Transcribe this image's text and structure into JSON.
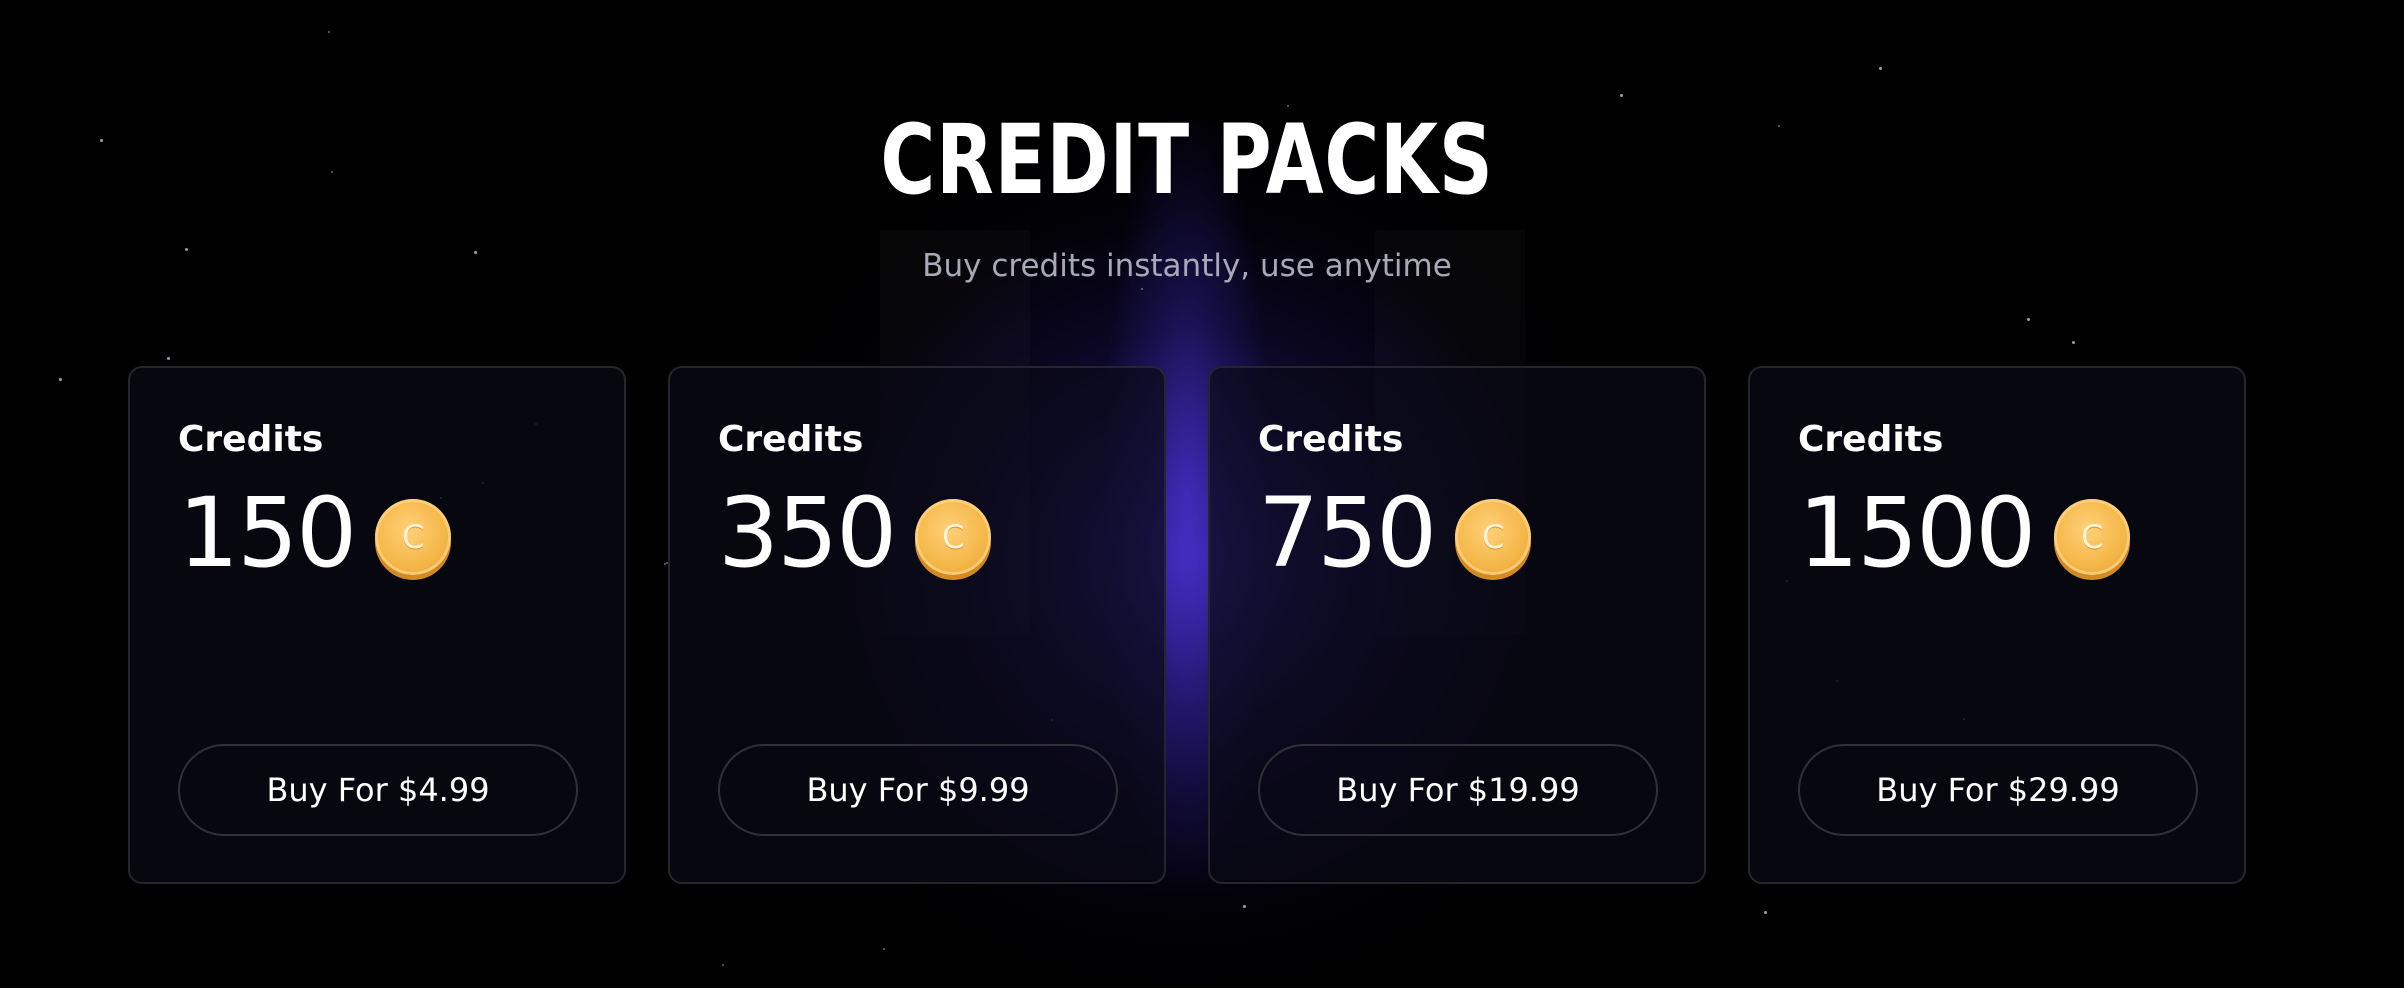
{
  "header": {
    "title": "CREDIT PACKS",
    "subtitle": "Buy credits instantly, use anytime"
  },
  "packs": [
    {
      "label": "Credits",
      "amount": "150",
      "coin_letter": "C",
      "button_label": "Buy For $4.99"
    },
    {
      "label": "Credits",
      "amount": "350",
      "coin_letter": "C",
      "button_label": "Buy For $9.99"
    },
    {
      "label": "Credits",
      "amount": "750",
      "coin_letter": "C",
      "button_label": "Buy For $19.99"
    },
    {
      "label": "Credits",
      "amount": "1500",
      "coin_letter": "C",
      "button_label": "Buy For $29.99"
    }
  ],
  "icons": {
    "coin": "coin-icon"
  },
  "colors": {
    "background": "#000000",
    "glow": "#4830d2",
    "card_background": "#0a0a16",
    "card_border": "#24252d",
    "coin": "#f5b84a",
    "subtitle": "#a7a9b6"
  }
}
